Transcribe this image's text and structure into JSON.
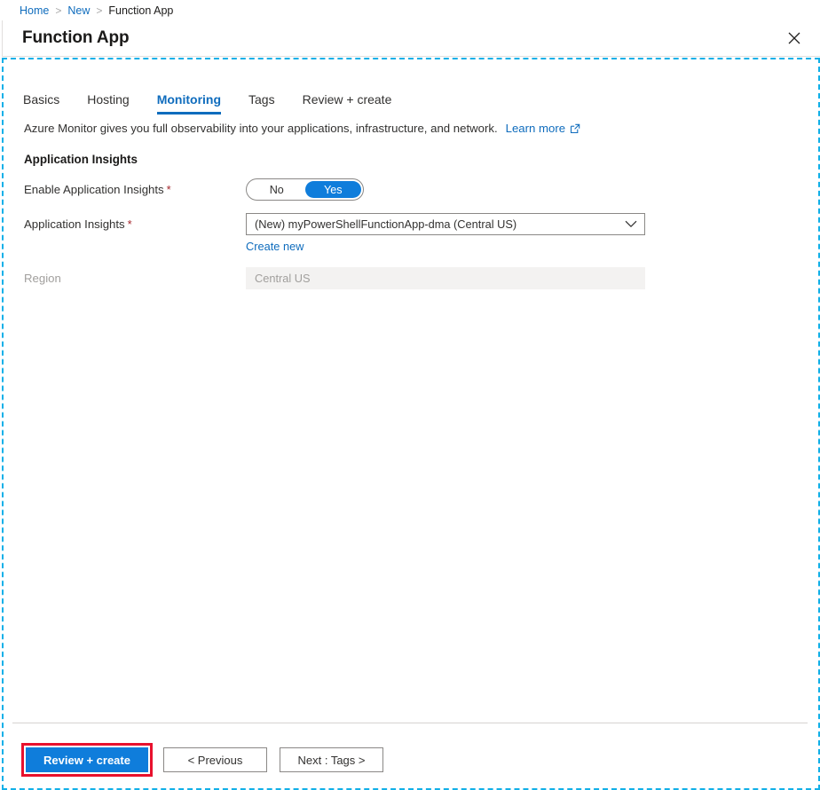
{
  "breadcrumb": {
    "items": [
      {
        "label": "Home",
        "link": true
      },
      {
        "label": "New",
        "link": true
      },
      {
        "label": "Function App",
        "link": false
      }
    ],
    "separator": ">"
  },
  "blade": {
    "title": "Function App",
    "close_icon": "close-icon"
  },
  "tabs": [
    {
      "label": "Basics",
      "active": false
    },
    {
      "label": "Hosting",
      "active": false
    },
    {
      "label": "Monitoring",
      "active": true
    },
    {
      "label": "Tags",
      "active": false
    },
    {
      "label": "Review + create",
      "active": false
    }
  ],
  "description": {
    "text": "Azure Monitor gives you full observability into your applications, infrastructure, and network.",
    "learn_more": "Learn more",
    "external_icon": "external-link-icon"
  },
  "section": {
    "heading": "Application Insights"
  },
  "fields": {
    "enable_app_insights": {
      "label": "Enable Application Insights",
      "required": "*",
      "options": [
        "No",
        "Yes"
      ],
      "selected": "Yes"
    },
    "app_insights": {
      "label": "Application Insights",
      "required": "*",
      "value": "(New) myPowerShellFunctionApp-dma (Central US)",
      "chevron_icon": "chevron-down-icon",
      "create_new": "Create new"
    },
    "region": {
      "label": "Region",
      "value": "Central US",
      "disabled": true
    }
  },
  "footer": {
    "review_create": "Review + create",
    "previous": "< Previous",
    "next": "Next : Tags >"
  },
  "colors": {
    "accent_blue": "#0f7ddb",
    "link_blue": "#0f6cbd",
    "required_red": "#a4262c",
    "highlight_red": "#e8112d",
    "focus_cyan": "#12b0e8",
    "disabled_gray": "#a19f9d"
  }
}
